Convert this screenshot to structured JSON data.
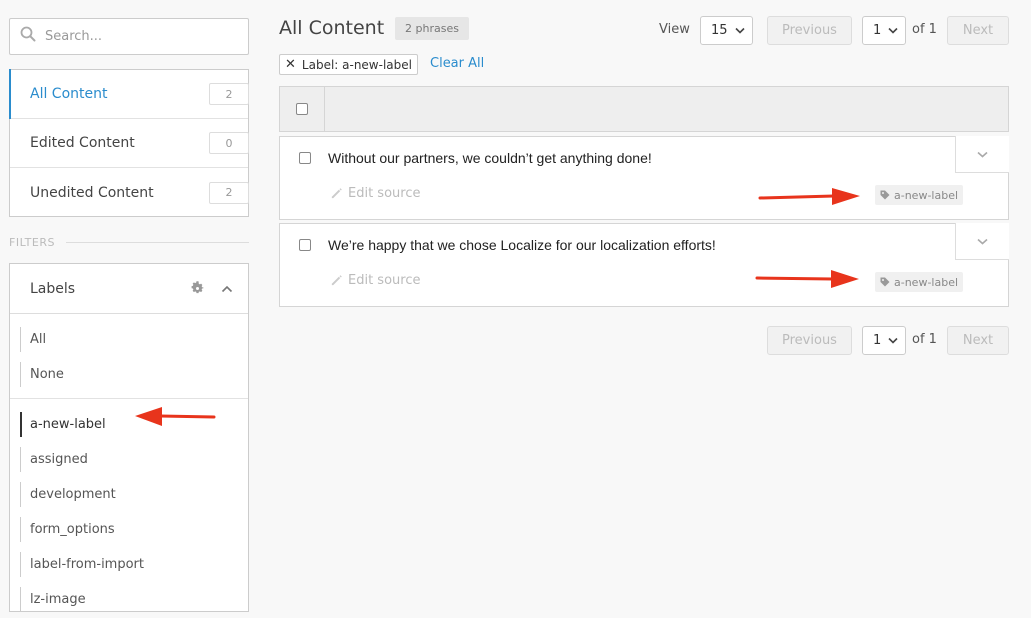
{
  "search": {
    "placeholder": "Search..."
  },
  "content_nav": [
    {
      "label": "All Content",
      "count": "2",
      "active": true
    },
    {
      "label": "Edited Content",
      "count": "0",
      "active": false
    },
    {
      "label": "Unedited Content",
      "count": "2",
      "active": false
    }
  ],
  "filters_heading": "FILTERS",
  "labels_panel": {
    "title": "Labels",
    "group1": [
      "All",
      "None"
    ],
    "group2": [
      "a-new-label",
      "assigned",
      "development",
      "form_options",
      "label-from-import",
      "lz-image"
    ],
    "selected": "a-new-label"
  },
  "main": {
    "title": "All Content",
    "phrases_badge": "2 phrases",
    "view_label": "View",
    "view_value": "15",
    "page_value": "1",
    "of_label": "of 1",
    "previous_label": "Previous",
    "next_label": "Next",
    "filter_chip": "Label: a-new-label",
    "filter_chip_x": "✕",
    "clear_all": "Clear All"
  },
  "phrases": [
    {
      "text": "Without our partners, we couldn’t get anything done!",
      "edit_label": "Edit source",
      "tag": "a-new-label"
    },
    {
      "text": "We’re happy that we chose Localize for our localization efforts!",
      "edit_label": "Edit source",
      "tag": "a-new-label"
    }
  ],
  "colors": {
    "accent": "#2a8ccd",
    "arrow": "#e8341c"
  },
  "icons": [
    "search-icon",
    "gear-icon",
    "chevron-up-icon",
    "chevron-down-icon",
    "pencil-icon",
    "tag-icon",
    "close-icon"
  ]
}
